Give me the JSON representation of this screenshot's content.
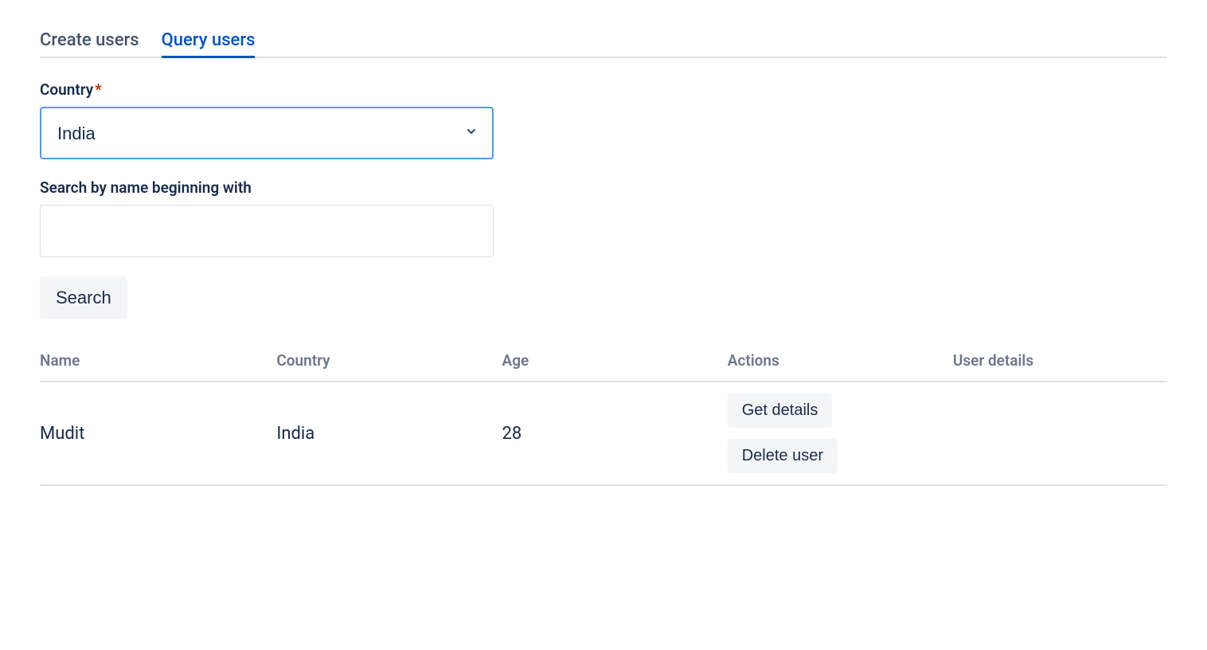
{
  "tabs": {
    "create_users": "Create users",
    "query_users": "Query users"
  },
  "form": {
    "country_label": "Country",
    "country_value": "India",
    "search_label": "Search by name beginning with",
    "search_value": "",
    "search_button": "Search"
  },
  "table": {
    "headers": {
      "name": "Name",
      "country": "Country",
      "age": "Age",
      "actions": "Actions",
      "user_details": "User details"
    },
    "rows": [
      {
        "name": "Mudit",
        "country": "India",
        "age": "28",
        "get_details": "Get details",
        "delete_user": "Delete user"
      }
    ]
  }
}
